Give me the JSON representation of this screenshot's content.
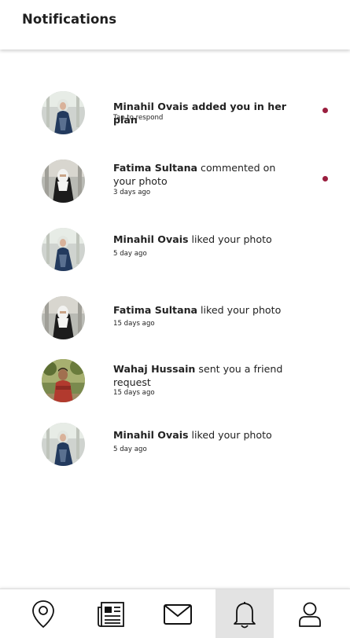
{
  "header": {
    "title": "Notifications"
  },
  "notifications": [
    {
      "name": "Minahil Ovais added you in her plan",
      "text": "",
      "time": "Tap to respond",
      "unread": true,
      "avatar": "avatar-minahil"
    },
    {
      "name": "Fatima Sultana",
      "text": " commented on your photo",
      "time": "3 days ago",
      "unread": true,
      "avatar": "avatar-fatima"
    },
    {
      "name": "Minahil Ovais",
      "text": " liked your photo",
      "time": "5 day ago",
      "unread": false,
      "avatar": "avatar-minahil"
    },
    {
      "name": "Fatima Sultana",
      "text": " liked your photo",
      "time": "15 days ago",
      "unread": false,
      "avatar": "avatar-fatima"
    },
    {
      "name": "Wahaj Hussain",
      "text": " sent you a friend request",
      "time": "15 days ago",
      "unread": false,
      "avatar": "avatar-wahaj"
    },
    {
      "name": "Minahil Ovais",
      "text": " liked your photo",
      "time": "5 day ago",
      "unread": false,
      "avatar": "avatar-minahil"
    }
  ],
  "nav": {
    "items": [
      {
        "icon": "map-pin-icon",
        "active": false
      },
      {
        "icon": "newspaper-icon",
        "active": false
      },
      {
        "icon": "mail-icon",
        "active": false
      },
      {
        "icon": "bell-icon",
        "active": true
      },
      {
        "icon": "profile-icon",
        "active": false
      }
    ]
  },
  "colors": {
    "unread_dot": "#9a1e3e",
    "active_tab": "#e3e3e3"
  }
}
